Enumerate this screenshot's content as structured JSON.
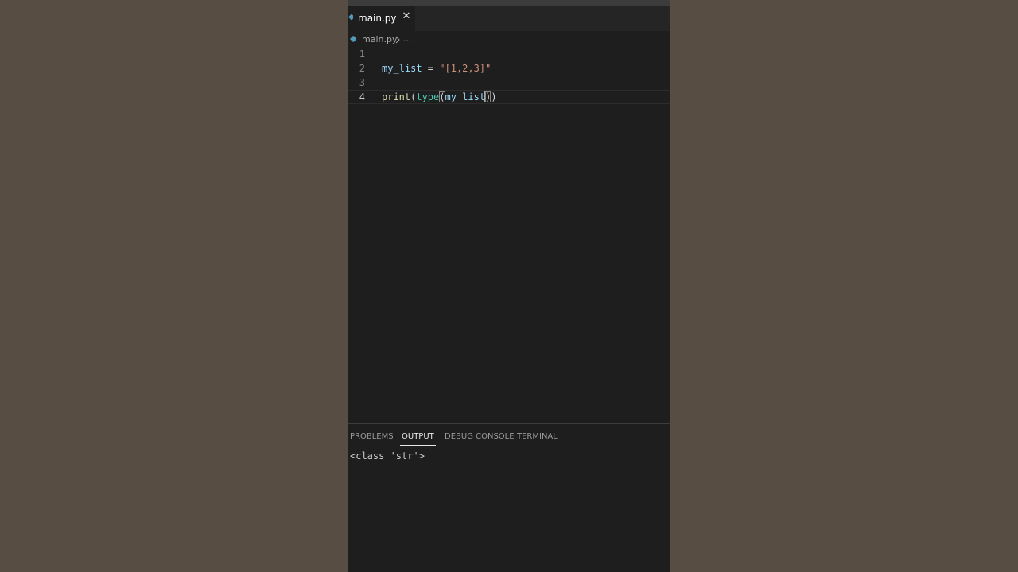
{
  "tab": {
    "label": "main.py",
    "close_glyph": "✕",
    "icon": "python-file-icon"
  },
  "breadcrumb": {
    "file": "main.py",
    "more": "..."
  },
  "editor": {
    "lines": [
      {
        "number": "1",
        "tokens": []
      },
      {
        "number": "2",
        "tokens": [
          "my_list",
          " = ",
          "\"[1,2,3]\""
        ]
      },
      {
        "number": "3",
        "tokens": []
      },
      {
        "number": "4",
        "tokens": [
          "print",
          "(",
          "type",
          "(",
          "my_list",
          ")",
          ")"
        ]
      }
    ],
    "current_line": 4
  },
  "panel": {
    "tabs": [
      {
        "label": "PROBLEMS",
        "active": false
      },
      {
        "label": "OUTPUT",
        "active": true
      },
      {
        "label": "DEBUG CONSOLE",
        "active": false
      },
      {
        "label": "TERMINAL",
        "active": false
      }
    ],
    "output": "<class 'str'>"
  },
  "colors": {
    "background": "#574d43",
    "editor_bg": "#1e1e1e",
    "variable": "#9cdcfe",
    "string": "#ce9178",
    "function": "#dcdcaa",
    "builtin": "#4ec9b0",
    "python_icon": "#519aba"
  }
}
